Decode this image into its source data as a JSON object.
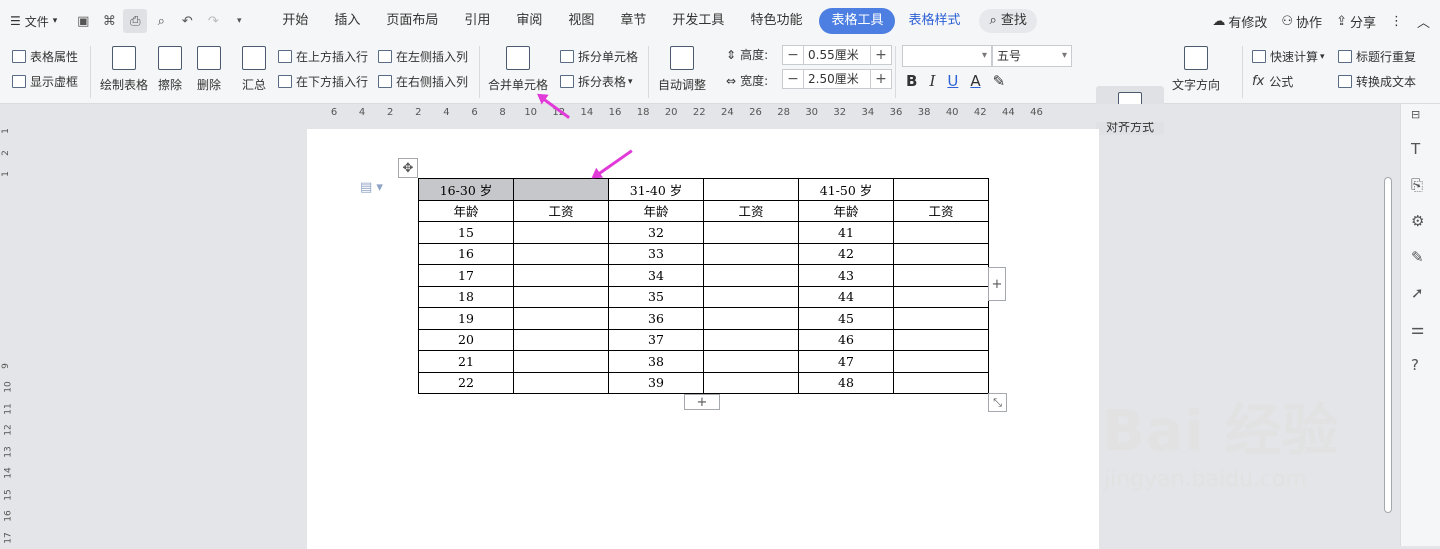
{
  "menubar": {
    "file_label": "文件",
    "tabs": [
      "开始",
      "插入",
      "页面布局",
      "引用",
      "审阅",
      "视图",
      "章节",
      "开发工具",
      "特色功能"
    ],
    "table_tools": "表格工具",
    "table_style": "表格样式",
    "search": "查找",
    "modify": "有修改",
    "collab": "协作",
    "share": "分享"
  },
  "ribbon": {
    "table_props": "表格属性",
    "show_grid": "显示虚框",
    "draw_table": "绘制表格",
    "erase": "擦除",
    "delete": "删除",
    "summary": "汇总",
    "insert_above": "在上方插入行",
    "insert_below": "在下方插入行",
    "insert_left": "在左侧插入列",
    "insert_right": "在右侧插入列",
    "merge_cells": "合并单元格",
    "split_cells": "拆分单元格",
    "split_table": "拆分表格",
    "auto_adjust": "自动调整",
    "height_label": "高度:",
    "height_value": "0.55厘米",
    "width_label": "宽度:",
    "width_value": "2.50厘米",
    "font_name": "",
    "font_size": "五号",
    "align": "对齐方式",
    "text_dir": "文字方向",
    "quick_calc": "快速计算",
    "formula": "公式",
    "repeat_header": "标题行重复",
    "to_text": "转换成文本"
  },
  "ruler_ticks": [
    "6",
    "4",
    "2",
    "2",
    "4",
    "6",
    "8",
    "10",
    "12",
    "14",
    "16",
    "18",
    "20",
    "22",
    "24",
    "26",
    "28",
    "30",
    "32",
    "34",
    "36",
    "38",
    "40",
    "42",
    "44",
    "46"
  ],
  "vruler_ticks": [
    "1",
    "2",
    "1",
    "9",
    "10",
    "11",
    "12",
    "13",
    "14",
    "15",
    "16",
    "17"
  ],
  "table": {
    "header1": [
      "16-30 岁",
      "",
      "31-40 岁",
      "",
      "41-50 岁",
      ""
    ],
    "header2": [
      "年龄",
      "工资",
      "年龄",
      "工资",
      "年龄",
      "工资"
    ],
    "rows": [
      [
        "15",
        "",
        "32",
        "",
        "41",
        ""
      ],
      [
        "16",
        "",
        "33",
        "",
        "42",
        ""
      ],
      [
        "17",
        "",
        "34",
        "",
        "43",
        ""
      ],
      [
        "18",
        "",
        "35",
        "",
        "44",
        ""
      ],
      [
        "19",
        "",
        "36",
        "",
        "45",
        ""
      ],
      [
        "20",
        "",
        "37",
        "",
        "46",
        ""
      ],
      [
        "21",
        "",
        "38",
        "",
        "47",
        ""
      ],
      [
        "22",
        "",
        "39",
        "",
        "48",
        ""
      ]
    ]
  },
  "watermark": {
    "brand": "Bai 经验",
    "url": "jingyan.baidu.com"
  },
  "colors": {
    "accent": "#4d7fe3",
    "arrow": "#e23ad8",
    "selected_cell": "#c5c7ca"
  }
}
